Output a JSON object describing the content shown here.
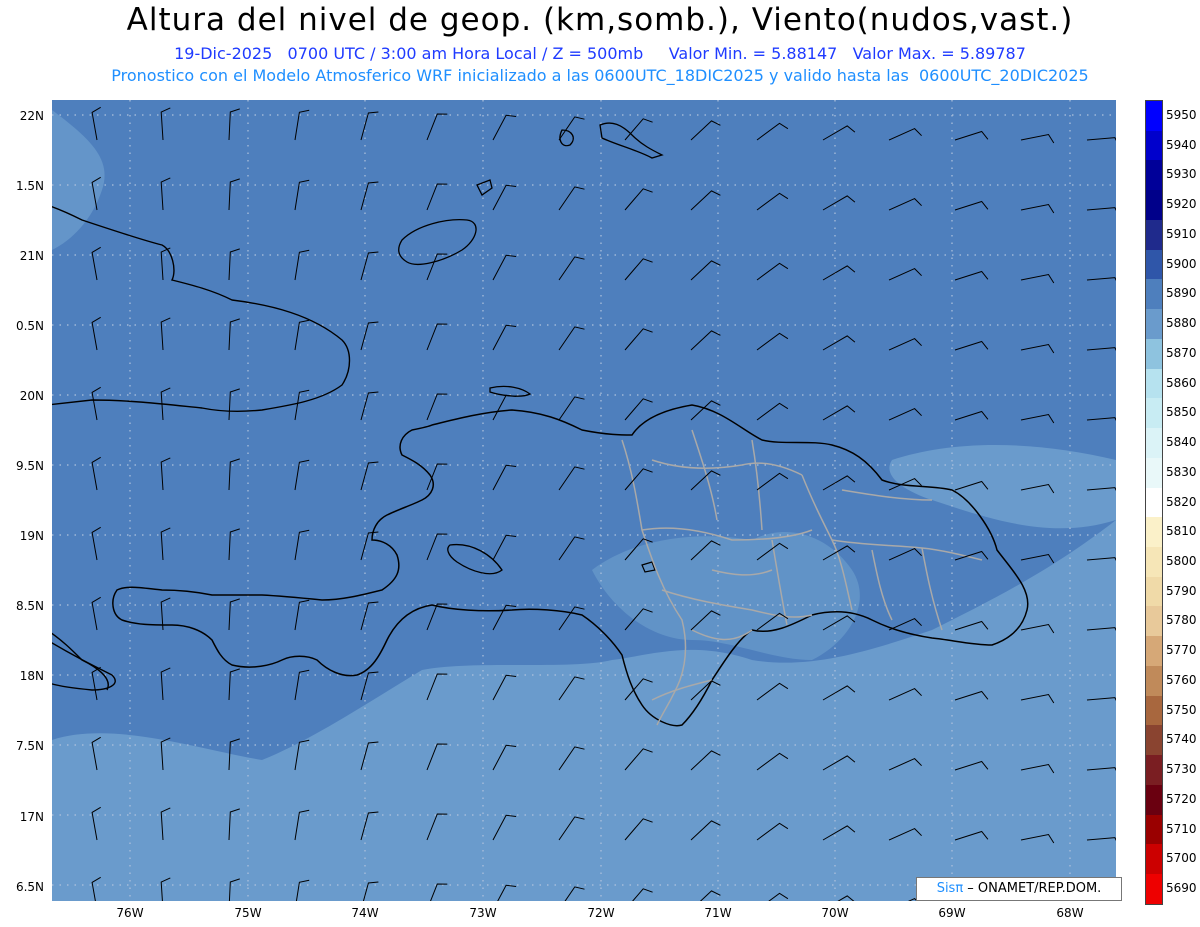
{
  "header": {
    "title": "Altura del nivel de geop. (km,somb.), Viento(nudos,vast.)",
    "line1": "19-Dic-2025   0700 UTC / 3:00 am Hora Local / Z = 500mb     Valor Min. = 5.88147   Valor Max. = 5.89787",
    "line2": "Pronostico con el Modelo Atmosferico WRF inicializado a las 0600UTC_18DIC2025 y valido hasta las  0600UTC_20DIC2025"
  },
  "map": {
    "lat_labels": [
      "22N",
      "1.5N",
      "21N",
      "0.5N",
      "20N",
      "9.5N",
      "19N",
      "8.5N",
      "18N",
      "7.5N",
      "17N",
      "6.5N"
    ],
    "lon_labels": [
      "76W",
      "75W",
      "74W",
      "73W",
      "72W",
      "71W",
      "70W",
      "69W",
      "68W"
    ],
    "background_color": "#4e7fbd",
    "lighter_shade_color": "#6a9bcc"
  },
  "colorbar": {
    "levels": [
      "5950",
      "5940",
      "5930",
      "5920",
      "5910",
      "5900",
      "5890",
      "5880",
      "5870",
      "5860",
      "5850",
      "5840",
      "5830",
      "5820",
      "5810",
      "5800",
      "5790",
      "5780",
      "5770",
      "5760",
      "5750",
      "5740",
      "5730",
      "5720",
      "5710",
      "5700",
      "5690"
    ],
    "colors": [
      "#0000ff",
      "#0000cc",
      "#000099",
      "#00008a",
      "#1f2a8c",
      "#2f56a9",
      "#4e7fbd",
      "#6a9bcc",
      "#8ec3df",
      "#b6e2ef",
      "#c8ecf3",
      "#dbf3f7",
      "#e9f8f9",
      "#ffffff",
      "#fbf1c9",
      "#f6e6b7",
      "#f0daa8",
      "#e8c99a",
      "#d6a877",
      "#c08a5a",
      "#a8673e",
      "#8a4430",
      "#7a1e22",
      "#6a0010",
      "#9a0000",
      "#cc0000",
      "#ee0000"
    ]
  },
  "credit": {
    "prefix": "Sisπ",
    "text": " – ONAMET/REP.DOM."
  }
}
